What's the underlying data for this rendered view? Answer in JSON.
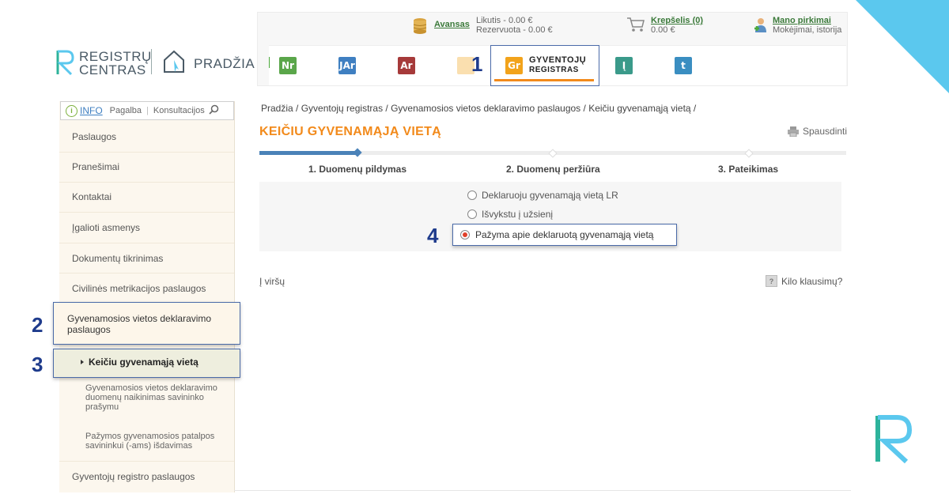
{
  "brand": {
    "logo_line1": "REGISTRŲ",
    "logo_line2": "CENTRAS",
    "home_label": "PRADŽIA",
    "accent": "#f28a1b",
    "corner_color": "#5bc8ee"
  },
  "header": {
    "avansas_label": "Avansas",
    "likutis": "Likutis - 0.00 €",
    "rezervuota": "Rezervuota - 0.00 €",
    "cart_label": "Krepšelis (0)",
    "cart_amount": "0.00 €",
    "purchases_label": "Mano pirkimai",
    "purchases_sub": "Mokėjimai, istorija"
  },
  "apps": [
    {
      "glyph": "Nr",
      "color": "#5aa64a",
      "icon": "nekilnojamojo-turto-icon"
    },
    {
      "glyph": "JAr",
      "color": "#3f7fc1",
      "icon": "juridiniu-asmenu-icon"
    },
    {
      "glyph": "Ar",
      "color": "#a63a3a",
      "icon": "adresu-registro-icon"
    },
    {
      "glyph": "Gr",
      "label1": "GYVENTOJŲ",
      "label2": "REGISTRAS",
      "color": "#f2a31b",
      "icon": "gyventoju-registras-icon"
    },
    {
      "glyph": "Į",
      "color": "#3a9a8a",
      "icon": "isakymu-icon"
    },
    {
      "glyph": "t",
      "color": "#3a8ec1",
      "icon": "turto-icon"
    }
  ],
  "markers": {
    "m1": "1",
    "m2": "2",
    "m3": "3",
    "m4": "4"
  },
  "info_bar": {
    "info": "INFO",
    "help": "Pagalba",
    "consult": "Konsultacijos"
  },
  "sidebar": {
    "items": [
      "Paslaugos",
      "Pranešimai",
      "Kontaktai",
      "Įgalioti asmenys",
      "Dokumentų tikrinimas",
      "Civilinės metrikacijos paslaugos"
    ],
    "active_group": "Gyvenamosios vietos deklaravimo paslaugos",
    "active_item": "Keičiu gyvenamąją vietą",
    "sub_items": [
      "Gyvenamosios vietos deklaravimo duomenų naikinimas savininko prašymu",
      "Pažymos gyvenamosios patalpos savininkui (-ams) išdavimas"
    ],
    "last_item": "Gyventojų registro paslaugos"
  },
  "main": {
    "breadcrumb": "Pradžia / Gyventojų registras / Gyvenamosios vietos deklaravimo paslaugos / Keičiu gyvenamąją vietą /",
    "title": "KEIČIU GYVENAMĄJĄ VIETĄ",
    "print_label": "Spausdinti",
    "progress": 0.168,
    "steps": [
      "1. Duomenų pildymas",
      "2. Duomenų peržiūra",
      "3. Pateikimas"
    ],
    "options": [
      {
        "label": "Deklaruoju gyvenamąją vietą LR",
        "checked": false
      },
      {
        "label": "Išvykstu į užsienį",
        "checked": false
      },
      {
        "label": "Pažyma apie deklaruotą gyvenamąją vietą",
        "checked": true
      }
    ],
    "top_link": "Į viršų",
    "help_link": "Kilo klausimų?"
  }
}
